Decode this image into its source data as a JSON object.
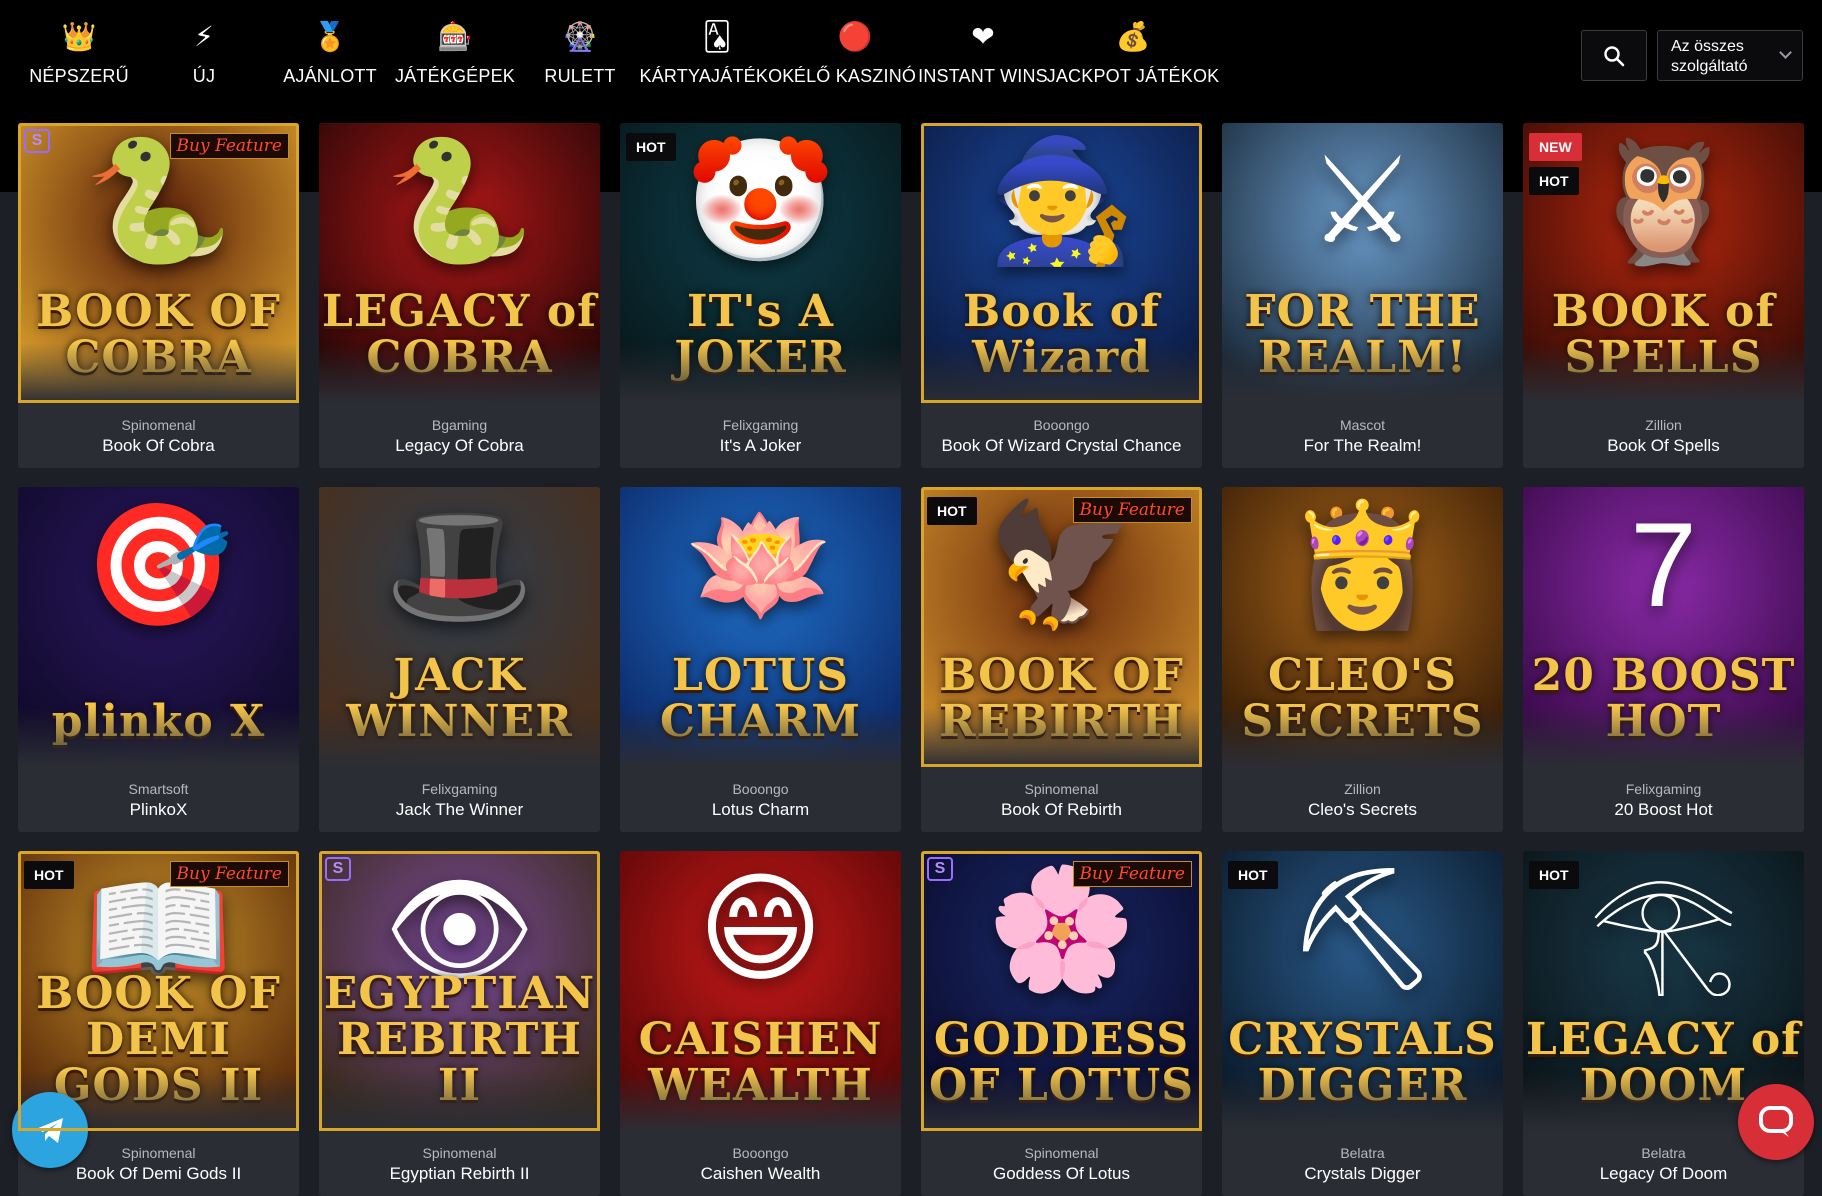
{
  "nav": [
    {
      "label": "NÉPSZERŰ",
      "icon": "crown-icon",
      "glyph": "👑"
    },
    {
      "label": "ÚJ",
      "icon": "lightning-icon",
      "glyph": "⚡"
    },
    {
      "label": "AJÁNLOTT",
      "icon": "medal-icon",
      "glyph": "🏅"
    },
    {
      "label": "JÁTÉKGÉPEK",
      "icon": "slot-machine-icon",
      "glyph": "🎰"
    },
    {
      "label": "RULETT",
      "icon": "roulette-icon",
      "glyph": "🎡"
    },
    {
      "label": "KÁRTYAJÁTÉKOK",
      "icon": "playing-card-icon",
      "glyph": "🂡"
    },
    {
      "label": "ÉLŐ KASZINÓ",
      "icon": "poker-chip-icon",
      "glyph": "🔴"
    },
    {
      "label": "INSTANT WINS",
      "icon": "heart-icon",
      "glyph": "❤"
    },
    {
      "label": "JACKPOT JÁTÉKOK",
      "icon": "money-bag-icon",
      "glyph": "💰"
    }
  ],
  "search": {
    "icon": "search-icon"
  },
  "provider_filter": {
    "line1": "Az összes",
    "line2": "szolgáltató"
  },
  "games": [
    {
      "provider": "Spinomenal",
      "name": "Book Of Cobra",
      "art_title": "BOOK OF COBRA",
      "bg": "#5a1e0a",
      "bg2": "#d49a2a",
      "badges": [],
      "buy": "Buy Feature",
      "s": true,
      "frame": true,
      "glyph": "🐍"
    },
    {
      "provider": "Bgaming",
      "name": "Legacy Of Cobra",
      "art_title": "LEGACY of COBRA",
      "bg": "#b01818",
      "bg2": "#2a0606",
      "badges": [],
      "buy": "",
      "s": false,
      "frame": false,
      "glyph": "🐍"
    },
    {
      "provider": "Felixgaming",
      "name": "It's A Joker",
      "art_title": "IT's A JOKER",
      "bg": "#0f3f4a",
      "bg2": "#07181c",
      "badges": [
        "HOT"
      ],
      "buy": "",
      "s": false,
      "frame": false,
      "glyph": "🤡"
    },
    {
      "provider": "Booongo",
      "name": "Book Of Wizard Crystal Chance",
      "art_title": "Book of Wizard",
      "bg": "#1b4aa0",
      "bg2": "#0c1b42",
      "badges": [],
      "buy": "",
      "s": false,
      "frame": true,
      "glyph": "🧙"
    },
    {
      "provider": "Mascot",
      "name": "For The Realm!",
      "art_title": "FOR THE REALM!",
      "bg": "#6a9ac9",
      "bg2": "#1a2a3a",
      "badges": [],
      "buy": "",
      "s": false,
      "frame": false,
      "glyph": "⚔"
    },
    {
      "provider": "Zillion",
      "name": "Book Of Spells",
      "art_title": "BOOK of SPELLS",
      "bg": "#b8280e",
      "bg2": "#3a0c06",
      "badges": [
        "NEW",
        "HOT"
      ],
      "buy": "",
      "s": false,
      "frame": false,
      "glyph": "🦉"
    },
    {
      "provider": "Smartsoft",
      "name": "PlinkoX",
      "art_title": "plinko X",
      "bg": "#2a1760",
      "bg2": "#100a2a",
      "badges": [],
      "buy": "",
      "s": false,
      "frame": false,
      "glyph": "🎯"
    },
    {
      "provider": "Felixgaming",
      "name": "Jack The Winner",
      "art_title": "JACK WINNER",
      "bg": "#2f3e4e",
      "bg2": "#4a2e1a",
      "badges": [],
      "buy": "",
      "s": false,
      "frame": false,
      "glyph": "🎩"
    },
    {
      "provider": "Booongo",
      "name": "Lotus Charm",
      "art_title": "LOTUS CHARM",
      "bg": "#1f6fc8",
      "bg2": "#0c2a6a",
      "badges": [],
      "buy": "",
      "s": false,
      "frame": false,
      "glyph": "🪷"
    },
    {
      "provider": "Spinomenal",
      "name": "Book Of Rebirth",
      "art_title": "BOOK OF REBIRTH",
      "bg": "#6a2a0c",
      "bg2": "#c98a2a",
      "badges": [
        "HOT"
      ],
      "buy": "Buy Feature",
      "s": false,
      "frame": true,
      "glyph": "🦅"
    },
    {
      "provider": "Zillion",
      "name": "Cleo's Secrets",
      "art_title": "CLEO'S SECRETS",
      "bg": "#a8651a",
      "bg2": "#3a1e06",
      "badges": [],
      "buy": "",
      "s": false,
      "frame": false,
      "glyph": "👸"
    },
    {
      "provider": "Felixgaming",
      "name": "20 Boost Hot",
      "art_title": "20 BOOST HOT",
      "bg": "#8a2aa8",
      "bg2": "#3a0a4a",
      "badges": [],
      "buy": "",
      "s": false,
      "frame": false,
      "glyph": "7"
    },
    {
      "provider": "Spinomenal",
      "name": "Book Of Demi Gods II",
      "art_title": "BOOK OF DEMI GODS II",
      "bg": "#c9952a",
      "bg2": "#5a2a0a",
      "badges": [
        "HOT"
      ],
      "buy": "Buy Feature",
      "s": false,
      "frame": true,
      "glyph": "📖"
    },
    {
      "provider": "Spinomenal",
      "name": "Egyptian Rebirth II",
      "art_title": "EGYPTIAN REBIRTH II",
      "bg": "#7a4a9a",
      "bg2": "#3a2a1a",
      "badges": [],
      "buy": "",
      "s": true,
      "frame": true,
      "glyph": "👁"
    },
    {
      "provider": "Booongo",
      "name": "Caishen Wealth",
      "art_title": "CAISHEN WEALTH",
      "bg": "#c81a1a",
      "bg2": "#5a0606",
      "badges": [],
      "buy": "",
      "s": false,
      "frame": false,
      "glyph": "😄"
    },
    {
      "provider": "Spinomenal",
      "name": "Goddess Of Lotus",
      "art_title": "GODDESS OF LOTUS",
      "bg": "#1a2a6a",
      "bg2": "#0a0a2a",
      "badges": [],
      "buy": "Buy Feature",
      "s": true,
      "frame": true,
      "glyph": "🌸"
    },
    {
      "provider": "Belatra",
      "name": "Crystals Digger",
      "art_title": "CRYSTALS DIGGER",
      "bg": "#2a5a8a",
      "bg2": "#0a1a2a",
      "badges": [
        "HOT"
      ],
      "buy": "",
      "s": false,
      "frame": false,
      "glyph": "⛏"
    },
    {
      "provider": "Belatra",
      "name": "Legacy Of Doom",
      "art_title": "LEGACY of DOOM",
      "bg": "#1a3a4a",
      "bg2": "#0a1418",
      "badges": [
        "HOT"
      ],
      "buy": "",
      "s": false,
      "frame": false,
      "glyph": "𓂀"
    }
  ],
  "floating": {
    "telegram": "telegram-icon",
    "chat": "chat-icon"
  }
}
